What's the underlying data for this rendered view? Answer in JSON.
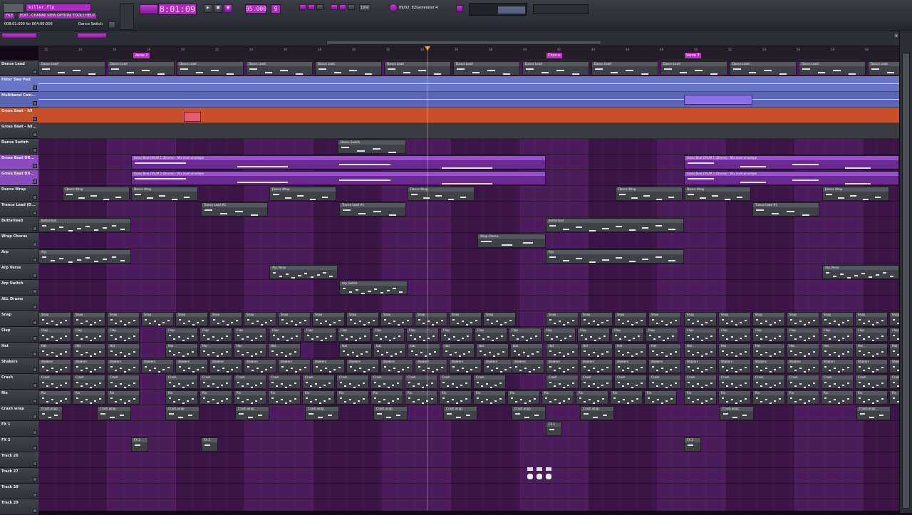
{
  "toolbar": {
    "file_title": "killer.flp",
    "menus": [
      "FILE",
      "EDIT",
      "CHANNELS",
      "VIEW",
      "OPTIONS",
      "TOOLS",
      "HELP"
    ],
    "hint_time": "008:01:000 for 004:00:000",
    "hint_pattern": "Dance Switch",
    "time_display": "8:01:09",
    "tempo": "95.000",
    "pattern_num": "9",
    "snap": "Line",
    "channel_plugin": "09/02: EZGenerator 4"
  },
  "ruler": {
    "markers": [
      {
        "label": "Verse 2"
      },
      {
        "label": "Chorus"
      },
      {
        "label": "Verse 3"
      }
    ],
    "ticks": [
      "12",
      "14",
      "16",
      "18",
      "20",
      "22",
      "24",
      "26",
      "28",
      "30",
      "32",
      "34",
      "36",
      "38",
      "40",
      "42",
      "44",
      "46",
      "48",
      "50",
      "52",
      "54",
      "56",
      "58",
      "60",
      "62",
      "64"
    ]
  },
  "tracks": [
    {
      "name": "Dance Lead"
    },
    {
      "name": "Filter Saw Pad"
    },
    {
      "name": "Multiband Com..."
    },
    {
      "name": "Gross Beat - All"
    },
    {
      "name": "Gross Beat - All..."
    },
    {
      "name": "Dance Switch"
    },
    {
      "name": "Gross Beat DR..."
    },
    {
      "name": "Gross Beat DR..."
    },
    {
      "name": "Dance Wrap"
    },
    {
      "name": "Trance Lead (D..."
    },
    {
      "name": "Butterlead"
    },
    {
      "name": "Wrap Chorus"
    },
    {
      "name": "Arp"
    },
    {
      "name": "Arp Verse"
    },
    {
      "name": "Arp Switch"
    },
    {
      "name": "ALL Drums"
    },
    {
      "name": "Snap"
    },
    {
      "name": "Clap"
    },
    {
      "name": "Hat"
    },
    {
      "name": "Shakers"
    },
    {
      "name": "Crash"
    },
    {
      "name": "Rix"
    },
    {
      "name": "Crash wrap"
    },
    {
      "name": "FX 1"
    },
    {
      "name": "FX 2"
    },
    {
      "name": "Track 26"
    },
    {
      "name": "Track 27"
    },
    {
      "name": "Track 28"
    },
    {
      "name": "Track 29"
    }
  ],
  "clips": {
    "dance_lead": "Dance Lead",
    "dance_switch": "Dance Switch",
    "gross_drum1": "Gross Beat DRUM 1 (Drums) - Mix level envelope",
    "gross_drum2": "Gross Beat DRUM 2 (Drums) - Mix level envelope",
    "dance_wrap": "Dance Wrap",
    "trance_lead": "Trance Lead #1",
    "butterlead": "Butterlead",
    "wrap_chorus": "Wrap Chorus",
    "arp": "Arp",
    "arp_verse": "Arp Verse",
    "arp_switch": "Arp Switch",
    "snap": "Snap",
    "clap": "Clap",
    "hat": "Hat",
    "shakers": "Shakers",
    "crash": "Crash",
    "rix": "Rix",
    "crash_wrap": "Crash wrap",
    "fx1": "FX 1",
    "fx2": "FX 2"
  },
  "colors": {
    "accent": "#b22ac4",
    "track_bg": "#3a1546",
    "gross_orange": "#c8502a",
    "pad_blue": "#6a74c8"
  }
}
